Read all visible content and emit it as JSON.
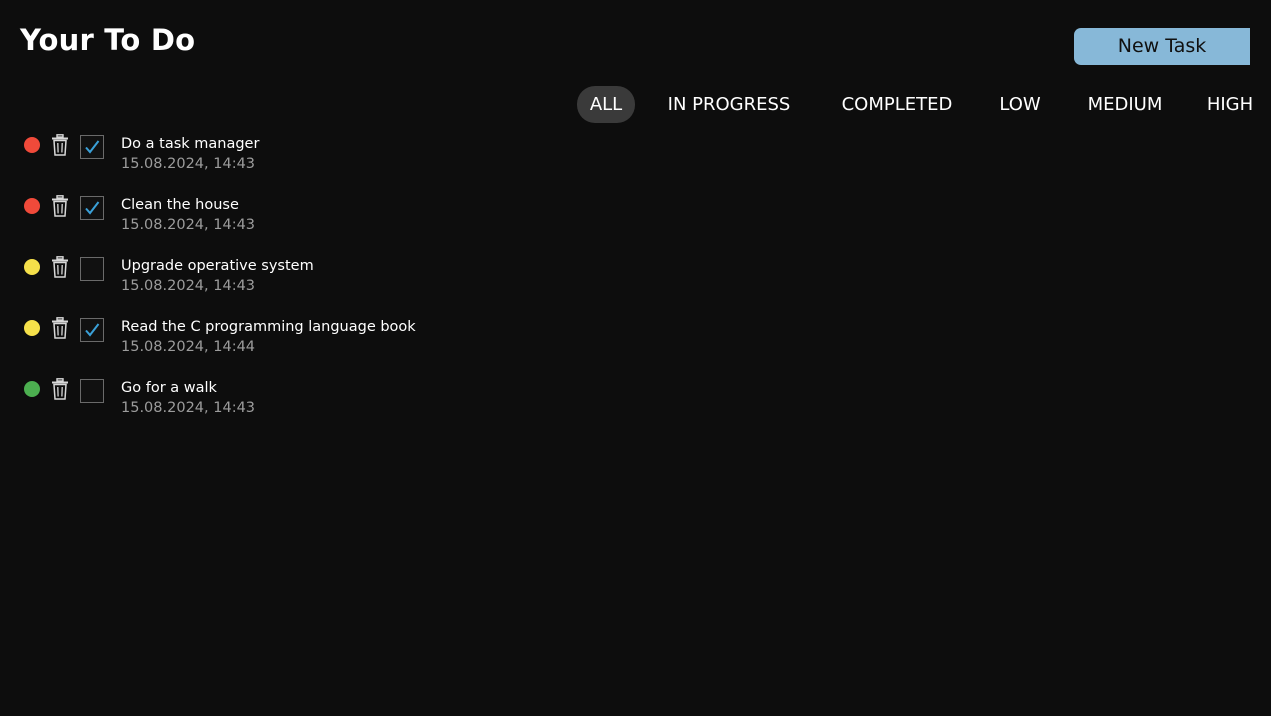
{
  "header": {
    "title": "Your To Do",
    "new_task_label": "New Task"
  },
  "filters": [
    {
      "label": "ALL",
      "active": true
    },
    {
      "label": "IN PROGRESS",
      "active": false
    },
    {
      "label": "COMPLETED",
      "active": false
    },
    {
      "label": "LOW",
      "active": false
    },
    {
      "label": "MEDIUM",
      "active": false
    },
    {
      "label": "HIGH",
      "active": false
    }
  ],
  "colors": {
    "background": "#0d0d0d",
    "accent_button": "#87b8d8",
    "checkmark": "#3aa0d8",
    "priority_high": "#f04a3a",
    "priority_medium": "#f5e04a",
    "priority_low": "#4caf50"
  },
  "tasks": [
    {
      "title": "Do a task manager",
      "date": "15.08.2024, 14:43",
      "priority": "high",
      "completed": true
    },
    {
      "title": "Clean the house",
      "date": "15.08.2024, 14:43",
      "priority": "high",
      "completed": true
    },
    {
      "title": "Upgrade operative system",
      "date": "15.08.2024, 14:43",
      "priority": "medium",
      "completed": false
    },
    {
      "title": "Read the C programming language book",
      "date": "15.08.2024, 14:44",
      "priority": "medium",
      "completed": true
    },
    {
      "title": "Go for a walk",
      "date": "15.08.2024, 14:43",
      "priority": "low",
      "completed": false
    }
  ],
  "icons": {
    "delete": "trash-icon",
    "check": "checkmark-icon",
    "priority": "priority-dot"
  }
}
